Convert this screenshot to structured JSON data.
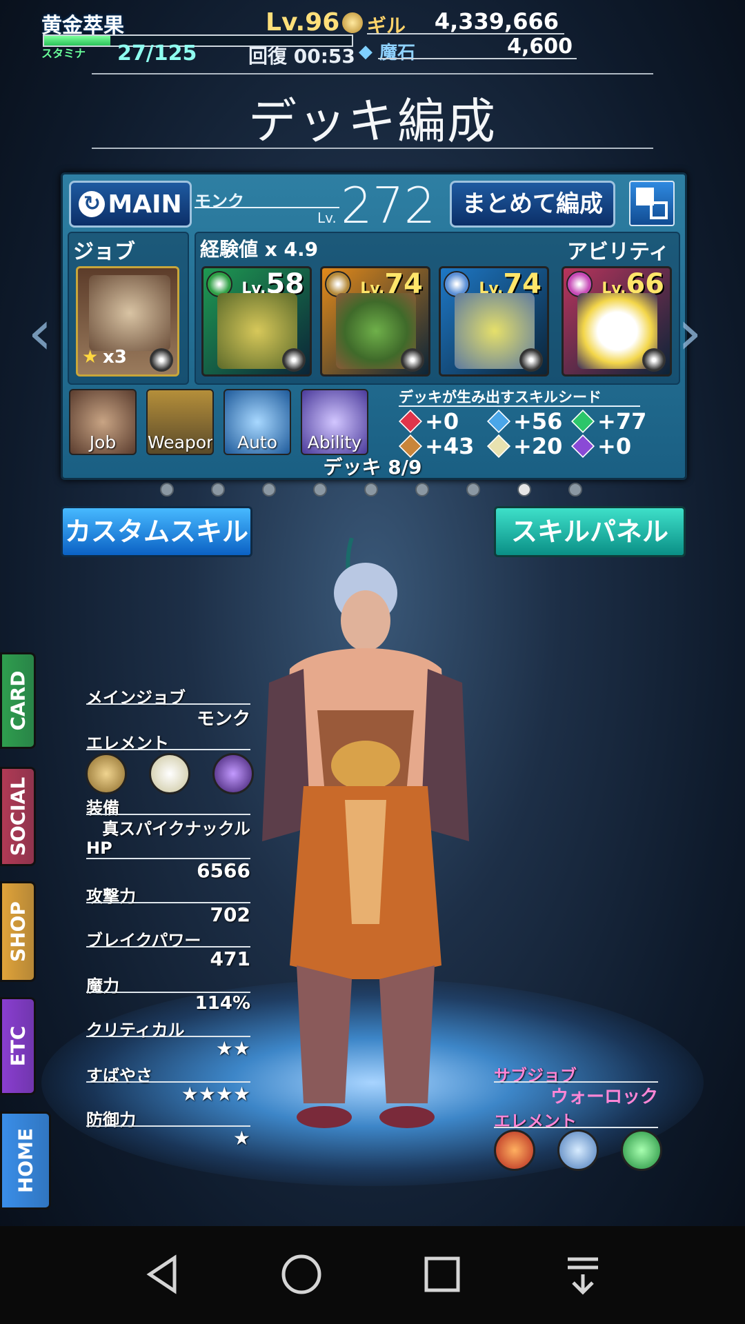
{
  "player": {
    "name": "黄金萃果",
    "level": "Lv.96",
    "stamina_label": "スタミナ",
    "stamina": "27/125",
    "stamina_fraction": 0.216,
    "recovery": "回復 00:53",
    "gil_label": "ギル",
    "gil": "4,339,666",
    "magicite_label": "魔石",
    "magicite": "4,600"
  },
  "title": "デッキ編成",
  "deck": {
    "main_button": "MAIN",
    "job_name": "モンク",
    "lv_label": "Lv.",
    "level": "272",
    "batch_button": "まとめて編成",
    "job_section": "ジョブ",
    "exp_section": "経験値 x 4.9",
    "ability_section": "アビリティ",
    "job_card_count": "x3",
    "cards": [
      {
        "lv_label": "Lv.",
        "level": "58",
        "element_color": "#2fa046",
        "frame_color": "#1f9a52"
      },
      {
        "lv_label": "Lv.",
        "level": "74",
        "element_color": "#b58a3a",
        "frame_color": "#e38a1a"
      },
      {
        "lv_label": "Lv.",
        "level": "74",
        "element_color": "#5a8fd6",
        "frame_color": "#1e78c6"
      },
      {
        "lv_label": "Lv.",
        "level": "66",
        "element_color": "#c74ab6",
        "frame_color": "#b8345c"
      }
    ],
    "slots": [
      "Job",
      "Weapon",
      "Auto",
      "Ability"
    ],
    "seed_title": "デッキが生み出すスキルシード",
    "seeds": [
      {
        "value": "+0",
        "color": "#e0344a"
      },
      {
        "value": "+56",
        "color": "#4aa6e8"
      },
      {
        "value": "+77",
        "color": "#2cc66a"
      },
      {
        "value": "+43",
        "color": "#c9853a"
      },
      {
        "value": "+20",
        "color": "#e8e2b0"
      },
      {
        "value": "+0",
        "color": "#8a4ad6"
      }
    ],
    "deck_count": "デッキ 8/9",
    "page_count": 9,
    "current_page": 8
  },
  "buttons": {
    "custom_skill": "カスタムスキル",
    "skill_panel": "スキルパネル"
  },
  "stats": {
    "main_job_label": "メインジョブ",
    "main_job": "モンク",
    "element_label": "エレメント",
    "equip_label": "装備",
    "equip": "真スパイクナックル",
    "hp_label": "HP",
    "hp": "6566",
    "attack_label": "攻撃力",
    "attack": "702",
    "break_label": "ブレイクパワー",
    "break": "471",
    "magic_label": "魔力",
    "magic": "114%",
    "critical_label": "クリティカル",
    "critical": "★★",
    "speed_label": "すばやさ",
    "speed": "★★★★",
    "defense_label": "防御力",
    "defense": "★"
  },
  "sub": {
    "sub_job_label": "サブジョブ",
    "sub_job": "ウォーロック",
    "element_label": "エレメント"
  },
  "tabs": [
    "CARD",
    "SOCIAL",
    "SHOP",
    "ETC",
    "HOME"
  ],
  "tab_colors": [
    "#2f9e4e",
    "#b03a55",
    "#e0a33a",
    "#8a3ed0",
    "#3a8ee8"
  ]
}
